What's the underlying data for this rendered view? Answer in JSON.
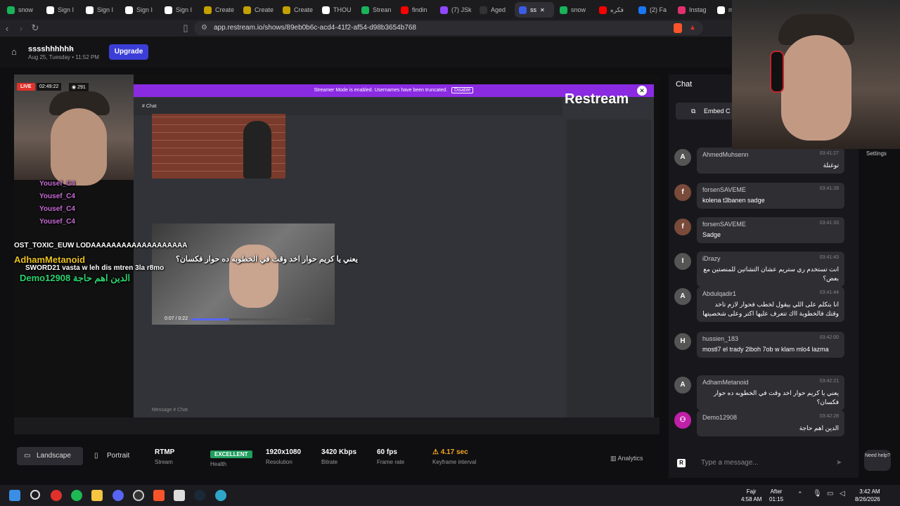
{
  "browser": {
    "tabs": [
      {
        "label": "snow",
        "color": "#19b45a"
      },
      {
        "label": "Sign I",
        "color": "#ffffff"
      },
      {
        "label": "Sign I",
        "color": "#ffffff"
      },
      {
        "label": "Sign I",
        "color": "#ffffff"
      },
      {
        "label": "Sign I",
        "color": "#ffffff"
      },
      {
        "label": "Create",
        "color": "#c4a000"
      },
      {
        "label": "Create",
        "color": "#c4a000"
      },
      {
        "label": "Create",
        "color": "#c4a000"
      },
      {
        "label": "THOU",
        "color": "#ffffff"
      },
      {
        "label": "Strean",
        "color": "#19b45a"
      },
      {
        "label": "findin",
        "color": "#ff0000"
      },
      {
        "label": "(7) JSk",
        "color": "#9146ff"
      },
      {
        "label": "Aged",
        "color": "#333333"
      },
      {
        "label": "ss",
        "color": "#3a5ce6"
      },
      {
        "label": "snow",
        "color": "#19b45a"
      },
      {
        "label": "فكره",
        "color": "#ff0000"
      },
      {
        "label": "(2) Fa",
        "color": "#1877f2"
      },
      {
        "label": "Instag",
        "color": "#e1306c"
      },
      {
        "label": "m",
        "color": "#ffffff"
      }
    ],
    "url": "app.restream.io/shows/89eb0b6c-acd4-41f2-af54-d98b3654b768"
  },
  "header": {
    "show_name": "sssshhhhhh",
    "show_date": "Aug 25, Tuesday • 11:52 PM",
    "upgrade": "Upgrade"
  },
  "preview": {
    "live": "LIVE",
    "elapsed": "02:49:22",
    "viewers": "291",
    "streamer_mode": "Streamer Mode is enabled. Usernames have been truncated.",
    "streamer_mode_btn": "Disable",
    "channel": "Chat",
    "restream_watermark": "Restream",
    "overlay_lines": [
      "Yousef_C4",
      "Yousef_C4",
      "Yousef_C4",
      "Yousef_C4",
      "OST_TOXIC_EUW LODAAAAAAAAAAAAAAAAAAA",
      "AdhamMetanoid",
      "SWORD21 vasta w leh dis mtren 3la r8mo",
      "Demo12908 الدين اهم حاجة"
    ],
    "arabic_overlay": "يعني يا كريم حوار اخد وقت في الخطوبه ده حوار فكسان؟",
    "video_time": "0:07 / 0:22",
    "message_placeholder": "Message # Chat"
  },
  "stream_stats": {
    "landscape": "Landscape",
    "portrait": "Portrait",
    "protocol": "RTMP",
    "protocol_label": "Stream",
    "health": "EXCELLENT",
    "health_label": "Health",
    "resolution": "1920x1080",
    "resolution_label": "Resolution",
    "bitrate": "3420 Kbps",
    "bitrate_label": "Bitrate",
    "framerate": "60 fps",
    "framerate_label": "Frame rate",
    "keyframe": "4.17 sec",
    "keyframe_label": "Keyframe interval",
    "analytics": "Analytics"
  },
  "chat": {
    "title": "Chat",
    "embed": "Embed C",
    "messages": [
      {
        "user": "AhmedMuhsenn",
        "time": "03:41:27",
        "text": "توغنلة",
        "avatar": "A",
        "color": "#555"
      },
      {
        "user": "forsenSAVEME",
        "time": "03:41:28",
        "text": "kolena t3banen sadge",
        "avatar": "f",
        "color": "#7a4a3a"
      },
      {
        "user": "forsenSAVEME",
        "time": "03:41:33",
        "text": "Sadge",
        "avatar": "f",
        "color": "#7a4a3a"
      },
      {
        "user": "iDrazy",
        "time": "03:41:43",
        "text": "انت تستخدم ري ستريم عشان التشاتين للمنصتين مع بعض؟",
        "avatar": "I",
        "color": "#555"
      },
      {
        "user": "Abdulqadir1",
        "time": "03:41:44",
        "text": "انا بتكلم على اللي بيقول لخطب فحوار لازم تاخد وقتك فالخطوبة ااك تتعرف عليها اكتر وعلى شخصيتها",
        "avatar": "A",
        "color": "#555"
      },
      {
        "user": "hussien_183",
        "time": "03:42:00",
        "text": "mostl7 el trady 2lboh 7ob w klam mlo4 lazma",
        "avatar": "H",
        "color": "#555"
      },
      {
        "user": "AdhamMetanoid",
        "time": "03:42:21",
        "text": "يعني يا كريم حوار اخد وقت في الخطوبه ده حوار فكسان؟",
        "avatar": "A",
        "color": "#555"
      },
      {
        "user": "Demo12908",
        "time": "03:42:28",
        "text": "الدين اهم حاجة",
        "avatar": "⚇",
        "color": "#c020a8"
      }
    ],
    "input_placeholder": "Type a message..."
  },
  "side": {
    "settings": "Settings",
    "need_help": "Need help?"
  },
  "taskbar": {
    "prayer_name": "Fajr",
    "prayer_time": "4:58 AM",
    "after_label": "After",
    "after_time": "01:15",
    "time": "3:42 AM",
    "date": "8/26/2026"
  }
}
